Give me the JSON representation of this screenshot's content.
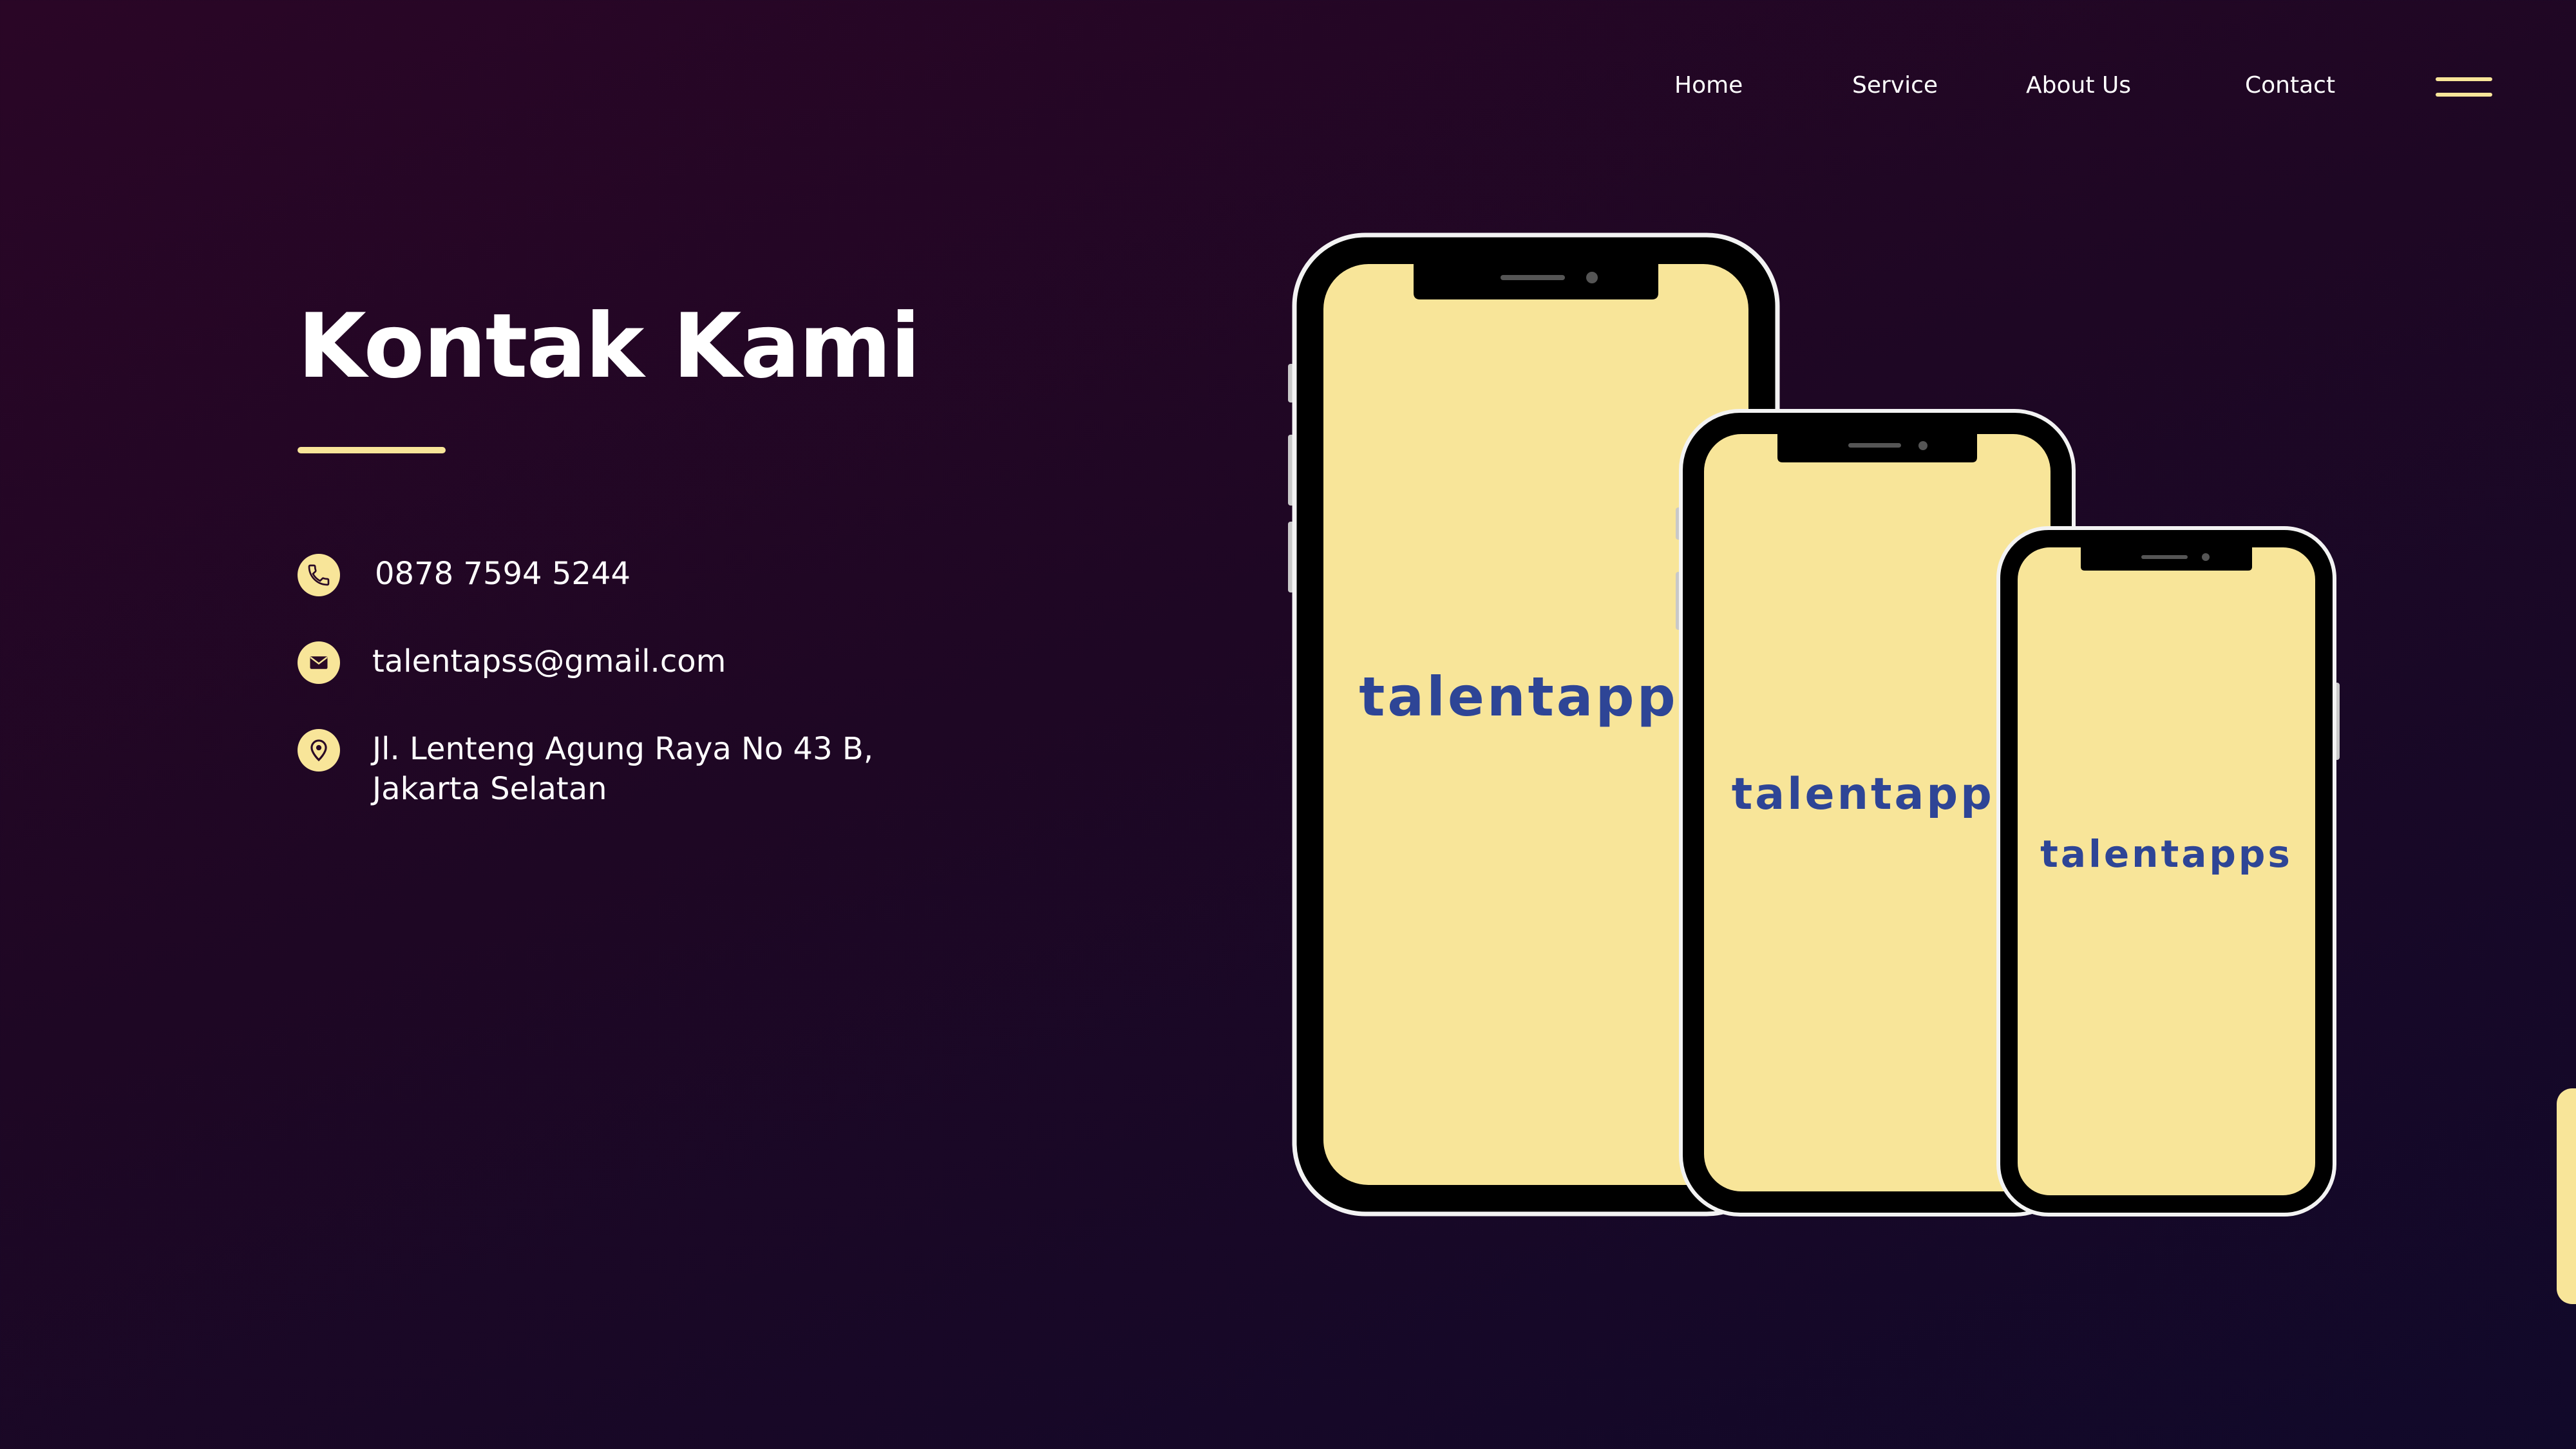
{
  "nav": {
    "items": [
      {
        "label": "Home"
      },
      {
        "label": "Service"
      },
      {
        "label": "About Us"
      },
      {
        "label": "Contact"
      }
    ],
    "menu_icon": "hamburger-menu-icon"
  },
  "hero": {
    "title": "Kontak Kami"
  },
  "contact": {
    "phone": "0878 7594 5244",
    "email": "talentapss@gmail.com",
    "address": "Jl. Lenteng Agung Raya No 43 B, Jakarta Selatan"
  },
  "mockups": {
    "brand": "talentapps"
  },
  "colors": {
    "accent": "#f8e599",
    "background": "#1e0724",
    "brand_blue": "#2e4596",
    "brand_red": "#e0334f"
  },
  "icons": {
    "phone": "phone-icon",
    "email": "mail-icon",
    "location": "map-pin-icon"
  }
}
